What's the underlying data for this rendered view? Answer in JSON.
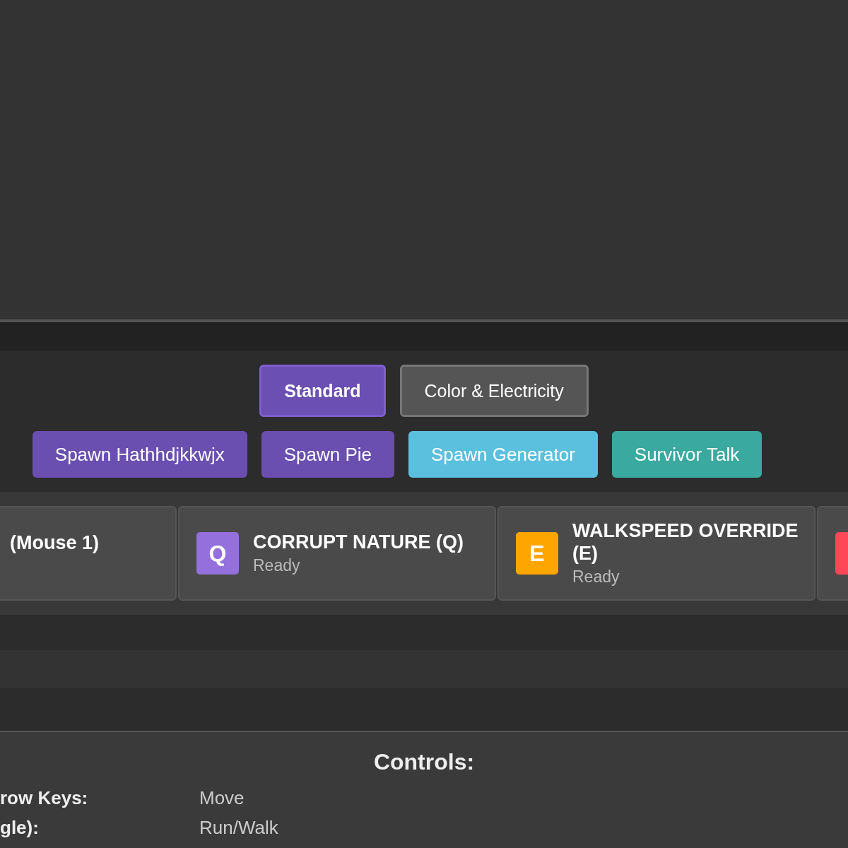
{
  "mode_tabs": [
    {
      "label": "Standard",
      "selected": true
    },
    {
      "label": "Color & Electricity",
      "selected": false
    }
  ],
  "spawn_buttons": [
    {
      "label": "Spawn Hathhdjkkwjx",
      "color": "#6a4fb0"
    },
    {
      "label": "Spawn Pie",
      "color": "#6a4fb0"
    },
    {
      "label": "Spawn Generator",
      "color": "#5bc0de"
    },
    {
      "label": "Survivor Talk",
      "color": "#3aa99f"
    }
  ],
  "abilities": [
    {
      "name": "(Mouse 1)"
    },
    {
      "key": "Q",
      "color": "#9370db",
      "name": "CORRUPT NATURE (Q)",
      "status": "Ready"
    },
    {
      "key": "E",
      "color": "#ffa500",
      "name": "WALKSPEED OVERRIDE (E)",
      "status": "Ready"
    },
    {
      "color": "#ff4757"
    }
  ],
  "controls": {
    "title": "Controls:",
    "rows": [
      {
        "key": "row Keys:",
        "action": "Move"
      },
      {
        "key": "gle):",
        "action": "Run/Walk"
      }
    ]
  }
}
